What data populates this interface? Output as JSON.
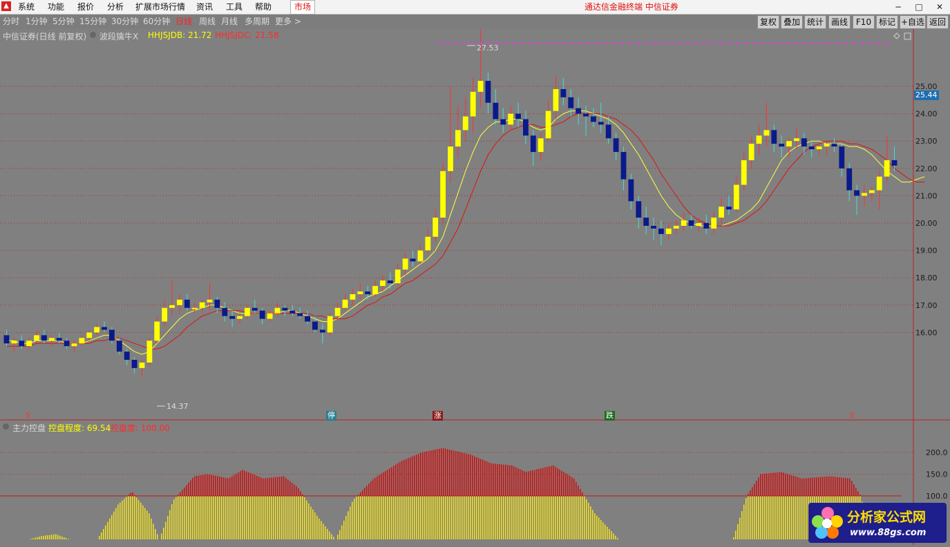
{
  "menu": {
    "items": [
      "系统",
      "功能",
      "报价",
      "分析",
      "扩展市场行情",
      "资讯",
      "工具",
      "帮助"
    ],
    "market_tab": "市场",
    "title": "通达信金融终端  中信证券"
  },
  "periods": {
    "items": [
      "分时",
      "1分钟",
      "5分钟",
      "15分钟",
      "30分钟",
      "60分钟",
      "日线",
      "周线",
      "月线",
      "多周期",
      "更多 >"
    ],
    "active_index": 6
  },
  "tools": [
    "复权",
    "叠加",
    "统计",
    "画线",
    "F10",
    "标记",
    "+自选",
    "返回"
  ],
  "main_panel": {
    "stock": "中信证券(日线 前复权)",
    "indicator": "波段擒牛X",
    "line1_label": "HHJSJDB: 21.72",
    "line2_label": "HHJSJDC: 21.58",
    "high_label": "27.53",
    "low_label": "14.37",
    "price_tag": "25.44",
    "y_ticks": [
      "25.00",
      "24.00",
      "23.00",
      "22.00",
      "21.00",
      "20.00",
      "19.00",
      "18.00",
      "17.00",
      "16.00"
    ]
  },
  "markers": {
    "s_left": "S",
    "stop": "停",
    "rise": "涨",
    "fall": "跌",
    "s_right": "S"
  },
  "sub_panel": {
    "name": "主力控盘",
    "label1": "控盘程度: 69.54",
    "label2": "控盘度: 100.00",
    "y_ticks": [
      "200.0",
      "150.0",
      "100.0"
    ]
  },
  "watermark": {
    "title": "分析家公式网",
    "url": "www.88gs.com"
  },
  "chart_data": {
    "type": "candlestick",
    "y_range": [
      13.8,
      28.0
    ],
    "bars": [
      {
        "o": 15.9,
        "h": 16.1,
        "l": 15.5,
        "c": 15.6
      },
      {
        "o": 15.6,
        "h": 15.8,
        "l": 15.3,
        "c": 15.7
      },
      {
        "o": 15.7,
        "h": 15.9,
        "l": 15.4,
        "c": 15.5
      },
      {
        "o": 15.5,
        "h": 15.8,
        "l": 15.4,
        "c": 15.7
      },
      {
        "o": 15.7,
        "h": 16.1,
        "l": 15.6,
        "c": 15.9
      },
      {
        "o": 15.9,
        "h": 16.1,
        "l": 15.6,
        "c": 15.7
      },
      {
        "o": 15.7,
        "h": 15.9,
        "l": 15.5,
        "c": 15.8
      },
      {
        "o": 15.8,
        "h": 16.0,
        "l": 15.6,
        "c": 15.7
      },
      {
        "o": 15.7,
        "h": 15.8,
        "l": 15.4,
        "c": 15.5
      },
      {
        "o": 15.5,
        "h": 15.7,
        "l": 15.3,
        "c": 15.6
      },
      {
        "o": 15.6,
        "h": 15.9,
        "l": 15.5,
        "c": 15.8
      },
      {
        "o": 15.8,
        "h": 16.1,
        "l": 15.7,
        "c": 16.0
      },
      {
        "o": 16.0,
        "h": 16.3,
        "l": 15.9,
        "c": 16.2
      },
      {
        "o": 16.2,
        "h": 16.4,
        "l": 16.0,
        "c": 16.1
      },
      {
        "o": 16.1,
        "h": 16.2,
        "l": 15.6,
        "c": 15.7
      },
      {
        "o": 15.7,
        "h": 15.8,
        "l": 15.2,
        "c": 15.3
      },
      {
        "o": 15.3,
        "h": 15.4,
        "l": 14.8,
        "c": 15.0
      },
      {
        "o": 15.0,
        "h": 15.1,
        "l": 14.5,
        "c": 14.7
      },
      {
        "o": 14.7,
        "h": 15.0,
        "l": 14.37,
        "c": 14.9
      },
      {
        "o": 14.9,
        "h": 15.8,
        "l": 14.8,
        "c": 15.7
      },
      {
        "o": 15.7,
        "h": 16.6,
        "l": 15.6,
        "c": 16.4
      },
      {
        "o": 16.4,
        "h": 17.2,
        "l": 16.2,
        "c": 16.9
      },
      {
        "o": 16.9,
        "h": 17.9,
        "l": 16.6,
        "c": 17.0
      },
      {
        "o": 17.0,
        "h": 17.4,
        "l": 16.7,
        "c": 17.2
      },
      {
        "o": 17.2,
        "h": 17.4,
        "l": 16.8,
        "c": 16.9
      },
      {
        "o": 16.9,
        "h": 17.1,
        "l": 16.7,
        "c": 16.9
      },
      {
        "o": 16.9,
        "h": 17.2,
        "l": 16.7,
        "c": 17.1
      },
      {
        "o": 17.1,
        "h": 17.8,
        "l": 16.8,
        "c": 17.2
      },
      {
        "o": 17.2,
        "h": 17.3,
        "l": 16.7,
        "c": 16.9
      },
      {
        "o": 16.9,
        "h": 17.1,
        "l": 16.4,
        "c": 16.6
      },
      {
        "o": 16.6,
        "h": 16.8,
        "l": 16.2,
        "c": 16.5
      },
      {
        "o": 16.5,
        "h": 16.7,
        "l": 16.3,
        "c": 16.6
      },
      {
        "o": 16.6,
        "h": 17.0,
        "l": 16.5,
        "c": 16.9
      },
      {
        "o": 16.9,
        "h": 17.2,
        "l": 16.7,
        "c": 16.8
      },
      {
        "o": 16.8,
        "h": 16.9,
        "l": 16.3,
        "c": 16.5
      },
      {
        "o": 16.5,
        "h": 16.8,
        "l": 16.4,
        "c": 16.7
      },
      {
        "o": 16.7,
        "h": 17.1,
        "l": 16.6,
        "c": 16.9
      },
      {
        "o": 16.9,
        "h": 17.0,
        "l": 16.6,
        "c": 16.8
      },
      {
        "o": 16.8,
        "h": 17.0,
        "l": 16.6,
        "c": 16.7
      },
      {
        "o": 16.7,
        "h": 16.9,
        "l": 16.5,
        "c": 16.6
      },
      {
        "o": 16.6,
        "h": 16.8,
        "l": 16.3,
        "c": 16.4
      },
      {
        "o": 16.4,
        "h": 16.6,
        "l": 16.0,
        "c": 16.1
      },
      {
        "o": 16.1,
        "h": 16.3,
        "l": 15.6,
        "c": 16.0
      },
      {
        "o": 16.0,
        "h": 16.7,
        "l": 15.9,
        "c": 16.6
      },
      {
        "o": 16.6,
        "h": 17.1,
        "l": 16.5,
        "c": 16.9
      },
      {
        "o": 16.9,
        "h": 17.4,
        "l": 16.8,
        "c": 17.2
      },
      {
        "o": 17.2,
        "h": 17.6,
        "l": 17.0,
        "c": 17.4
      },
      {
        "o": 17.4,
        "h": 17.8,
        "l": 17.2,
        "c": 17.5
      },
      {
        "o": 17.5,
        "h": 17.7,
        "l": 17.2,
        "c": 17.4
      },
      {
        "o": 17.4,
        "h": 17.9,
        "l": 17.3,
        "c": 17.7
      },
      {
        "o": 17.7,
        "h": 18.1,
        "l": 17.5,
        "c": 17.9
      },
      {
        "o": 17.9,
        "h": 18.2,
        "l": 17.6,
        "c": 17.8
      },
      {
        "o": 17.8,
        "h": 18.5,
        "l": 17.7,
        "c": 18.3
      },
      {
        "o": 18.3,
        "h": 18.9,
        "l": 18.1,
        "c": 18.7
      },
      {
        "o": 18.7,
        "h": 19.0,
        "l": 18.4,
        "c": 18.6
      },
      {
        "o": 18.6,
        "h": 19.2,
        "l": 18.5,
        "c": 19.0
      },
      {
        "o": 19.0,
        "h": 19.8,
        "l": 18.9,
        "c": 19.5
      },
      {
        "o": 19.5,
        "h": 20.5,
        "l": 19.3,
        "c": 20.2
      },
      {
        "o": 20.2,
        "h": 22.2,
        "l": 20.0,
        "c": 21.9
      },
      {
        "o": 21.9,
        "h": 25.0,
        "l": 21.5,
        "c": 22.8
      },
      {
        "o": 22.8,
        "h": 24.3,
        "l": 22.4,
        "c": 23.4
      },
      {
        "o": 23.4,
        "h": 24.6,
        "l": 23.0,
        "c": 23.9
      },
      {
        "o": 23.9,
        "h": 25.3,
        "l": 23.3,
        "c": 24.8
      },
      {
        "o": 24.8,
        "h": 27.53,
        "l": 24.2,
        "c": 25.2
      },
      {
        "o": 25.2,
        "h": 25.5,
        "l": 24.0,
        "c": 24.4
      },
      {
        "o": 24.4,
        "h": 24.9,
        "l": 23.6,
        "c": 23.8
      },
      {
        "o": 23.8,
        "h": 24.2,
        "l": 23.3,
        "c": 23.6
      },
      {
        "o": 23.6,
        "h": 24.3,
        "l": 23.4,
        "c": 24.0
      },
      {
        "o": 24.0,
        "h": 24.4,
        "l": 23.5,
        "c": 23.8
      },
      {
        "o": 23.8,
        "h": 24.1,
        "l": 22.9,
        "c": 23.2
      },
      {
        "o": 23.2,
        "h": 23.4,
        "l": 22.1,
        "c": 22.6
      },
      {
        "o": 22.6,
        "h": 23.3,
        "l": 22.3,
        "c": 23.1
      },
      {
        "o": 23.1,
        "h": 24.5,
        "l": 23.0,
        "c": 24.1
      },
      {
        "o": 24.1,
        "h": 25.4,
        "l": 23.8,
        "c": 24.9
      },
      {
        "o": 24.9,
        "h": 25.3,
        "l": 24.3,
        "c": 24.6
      },
      {
        "o": 24.6,
        "h": 24.9,
        "l": 23.9,
        "c": 24.2
      },
      {
        "o": 24.2,
        "h": 24.6,
        "l": 23.6,
        "c": 24.0
      },
      {
        "o": 24.0,
        "h": 24.3,
        "l": 23.2,
        "c": 23.9
      },
      {
        "o": 23.9,
        "h": 24.2,
        "l": 23.5,
        "c": 23.7
      },
      {
        "o": 23.7,
        "h": 24.4,
        "l": 23.3,
        "c": 23.6
      },
      {
        "o": 23.6,
        "h": 23.9,
        "l": 22.9,
        "c": 23.1
      },
      {
        "o": 23.1,
        "h": 23.3,
        "l": 22.3,
        "c": 22.6
      },
      {
        "o": 22.6,
        "h": 22.8,
        "l": 21.2,
        "c": 21.6
      },
      {
        "o": 21.6,
        "h": 21.8,
        "l": 20.5,
        "c": 20.8
      },
      {
        "o": 20.8,
        "h": 21.0,
        "l": 19.8,
        "c": 20.2
      },
      {
        "o": 20.2,
        "h": 20.6,
        "l": 19.6,
        "c": 19.9
      },
      {
        "o": 19.9,
        "h": 20.2,
        "l": 19.4,
        "c": 19.8
      },
      {
        "o": 19.8,
        "h": 20.1,
        "l": 19.2,
        "c": 19.6
      },
      {
        "o": 19.6,
        "h": 20.0,
        "l": 19.4,
        "c": 19.8
      },
      {
        "o": 19.8,
        "h": 20.1,
        "l": 19.6,
        "c": 19.9
      },
      {
        "o": 19.9,
        "h": 20.4,
        "l": 19.7,
        "c": 20.1
      },
      {
        "o": 20.1,
        "h": 20.3,
        "l": 19.8,
        "c": 19.9
      },
      {
        "o": 19.9,
        "h": 20.2,
        "l": 19.7,
        "c": 20.0
      },
      {
        "o": 20.0,
        "h": 20.3,
        "l": 19.6,
        "c": 19.8
      },
      {
        "o": 19.8,
        "h": 20.4,
        "l": 19.6,
        "c": 20.2
      },
      {
        "o": 20.2,
        "h": 20.9,
        "l": 20.0,
        "c": 20.6
      },
      {
        "o": 20.6,
        "h": 21.0,
        "l": 20.3,
        "c": 20.5
      },
      {
        "o": 20.5,
        "h": 21.7,
        "l": 20.4,
        "c": 21.4
      },
      {
        "o": 21.4,
        "h": 22.6,
        "l": 21.2,
        "c": 22.3
      },
      {
        "o": 22.3,
        "h": 23.2,
        "l": 22.0,
        "c": 22.9
      },
      {
        "o": 22.9,
        "h": 23.6,
        "l": 22.5,
        "c": 23.2
      },
      {
        "o": 23.2,
        "h": 24.4,
        "l": 22.8,
        "c": 23.4
      },
      {
        "o": 23.4,
        "h": 23.6,
        "l": 22.6,
        "c": 22.9
      },
      {
        "o": 22.9,
        "h": 23.2,
        "l": 22.4,
        "c": 22.8
      },
      {
        "o": 22.8,
        "h": 23.1,
        "l": 22.4,
        "c": 23.0
      },
      {
        "o": 23.0,
        "h": 23.5,
        "l": 22.7,
        "c": 23.1
      },
      {
        "o": 23.1,
        "h": 23.3,
        "l": 22.5,
        "c": 22.8
      },
      {
        "o": 22.8,
        "h": 23.0,
        "l": 22.4,
        "c": 22.7
      },
      {
        "o": 22.7,
        "h": 22.9,
        "l": 22.5,
        "c": 22.8
      },
      {
        "o": 22.8,
        "h": 23.0,
        "l": 22.5,
        "c": 22.9
      },
      {
        "o": 22.9,
        "h": 23.1,
        "l": 22.6,
        "c": 22.8
      },
      {
        "o": 22.8,
        "h": 22.9,
        "l": 21.7,
        "c": 22.0
      },
      {
        "o": 22.0,
        "h": 22.2,
        "l": 20.8,
        "c": 21.2
      },
      {
        "o": 21.2,
        "h": 21.4,
        "l": 20.3,
        "c": 21.0
      },
      {
        "o": 21.0,
        "h": 21.4,
        "l": 20.6,
        "c": 21.1
      },
      {
        "o": 21.1,
        "h": 21.3,
        "l": 20.8,
        "c": 21.2
      },
      {
        "o": 21.2,
        "h": 21.9,
        "l": 20.5,
        "c": 21.7
      },
      {
        "o": 21.7,
        "h": 23.2,
        "l": 21.5,
        "c": 22.3
      },
      {
        "o": 22.3,
        "h": 22.8,
        "l": 21.9,
        "c": 22.1
      }
    ],
    "ma1": [
      15.7,
      15.7,
      15.6,
      15.6,
      15.7,
      15.7,
      15.7,
      15.7,
      15.6,
      15.6,
      15.6,
      15.7,
      15.8,
      15.9,
      15.9,
      15.7,
      15.5,
      15.3,
      15.2,
      15.3,
      15.6,
      15.9,
      16.2,
      16.5,
      16.7,
      16.8,
      16.9,
      17.0,
      17.0,
      16.9,
      16.8,
      16.7,
      16.7,
      16.7,
      16.7,
      16.7,
      16.7,
      16.8,
      16.8,
      16.7,
      16.6,
      16.5,
      16.4,
      16.4,
      16.5,
      16.7,
      16.9,
      17.1,
      17.3,
      17.4,
      17.5,
      17.7,
      17.9,
      18.1,
      18.3,
      18.5,
      18.7,
      19.0,
      19.5,
      20.3,
      21.1,
      21.9,
      22.6,
      23.2,
      23.5,
      23.7,
      23.7,
      23.8,
      23.8,
      23.7,
      23.5,
      23.4,
      23.5,
      23.8,
      24.0,
      24.1,
      24.1,
      24.1,
      24.0,
      23.9,
      23.8,
      23.6,
      23.3,
      22.9,
      22.5,
      22.0,
      21.5,
      21.0,
      20.6,
      20.3,
      20.1,
      20.0,
      19.9,
      19.9,
      19.9,
      19.9,
      20.0,
      20.1,
      20.3,
      20.5,
      20.8,
      21.3,
      21.8,
      22.3,
      22.6,
      22.8,
      22.9,
      23.0,
      23.0,
      22.9,
      22.9,
      22.9,
      22.8,
      22.8,
      22.7,
      22.5,
      22.2,
      21.9,
      21.7,
      21.5,
      21.5,
      21.6,
      21.7
    ],
    "ma2": [
      15.5,
      15.5,
      15.5,
      15.5,
      15.6,
      15.6,
      15.6,
      15.6,
      15.6,
      15.6,
      15.6,
      15.6,
      15.7,
      15.7,
      15.8,
      15.8,
      15.7,
      15.6,
      15.5,
      15.4,
      15.4,
      15.5,
      15.7,
      15.9,
      16.2,
      16.4,
      16.6,
      16.7,
      16.8,
      16.8,
      16.8,
      16.8,
      16.7,
      16.7,
      16.7,
      16.7,
      16.7,
      16.7,
      16.7,
      16.7,
      16.7,
      16.6,
      16.6,
      16.5,
      16.5,
      16.5,
      16.6,
      16.8,
      17.0,
      17.1,
      17.3,
      17.4,
      17.6,
      17.8,
      17.9,
      18.1,
      18.3,
      18.5,
      18.8,
      19.3,
      19.8,
      20.5,
      21.2,
      21.9,
      22.5,
      22.9,
      23.2,
      23.4,
      23.5,
      23.6,
      23.6,
      23.5,
      23.5,
      23.6,
      23.7,
      23.9,
      24.0,
      24.0,
      24.0,
      24.0,
      23.9,
      23.8,
      23.6,
      23.4,
      23.1,
      22.7,
      22.3,
      21.8,
      21.4,
      21.0,
      20.6,
      20.3,
      20.1,
      20.0,
      19.9,
      19.9,
      19.9,
      20.0,
      20.1,
      20.3,
      20.5,
      20.8,
      21.2,
      21.6,
      22.0,
      22.3,
      22.6,
      22.8,
      22.9,
      23.0,
      23.0,
      23.0,
      22.9,
      22.9,
      22.8,
      22.7,
      22.5,
      22.3,
      22.0,
      21.8,
      21.6,
      21.5,
      21.5
    ]
  }
}
